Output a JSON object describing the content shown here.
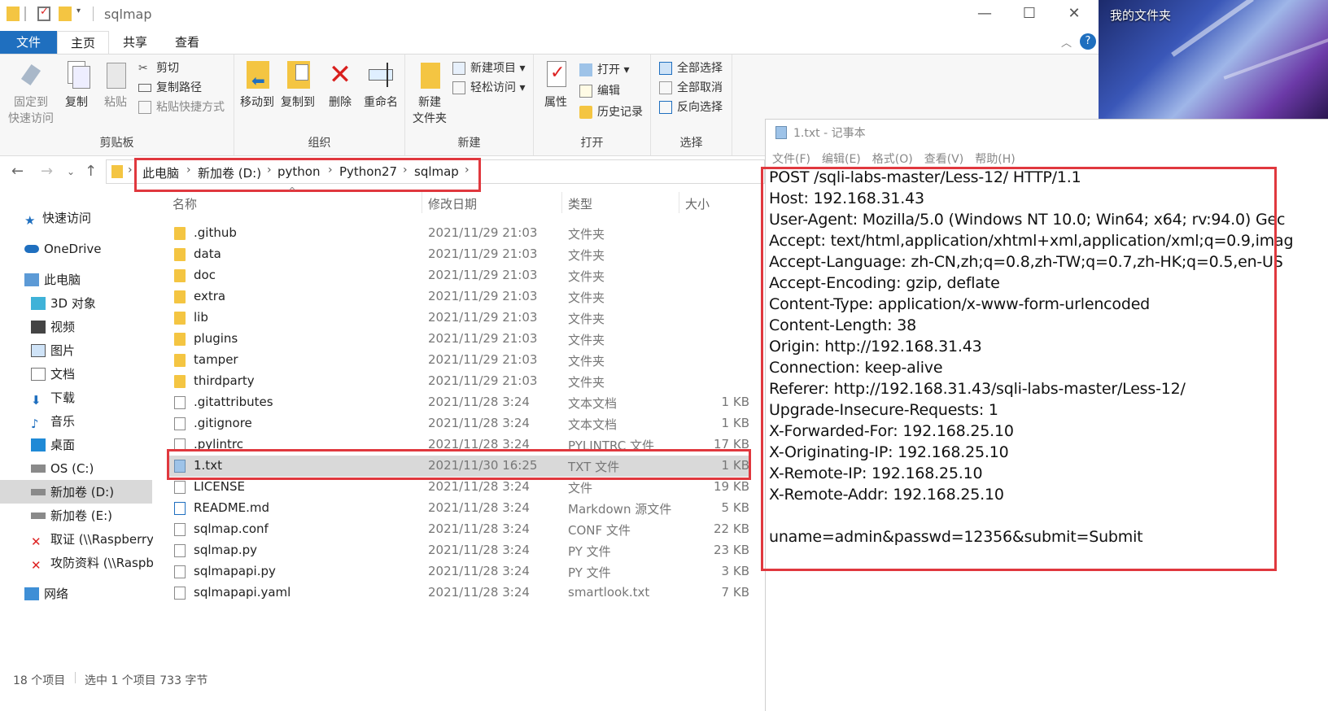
{
  "explorer": {
    "window_title": "sqlmap",
    "tabs": {
      "file": "文件",
      "home": "主页",
      "share": "共享",
      "view": "查看"
    },
    "ribbon": {
      "clipboard": {
        "label": "剪贴板",
        "pin": "固定到\n快速访问",
        "pin_l1": "固定到",
        "pin_l2": "快速访问",
        "copy": "复制",
        "paste": "粘贴",
        "cut": "剪切",
        "copy_path": "复制路径",
        "paste_shortcut": "粘贴快捷方式"
      },
      "organize": {
        "label": "组织",
        "move_to": "移动到",
        "copy_to": "复制到",
        "delete": "删除",
        "rename": "重命名"
      },
      "new": {
        "label": "新建",
        "new_folder_l1": "新建",
        "new_folder_l2": "文件夹",
        "new_item": "新建项目",
        "easy_access": "轻松访问"
      },
      "open": {
        "label": "打开",
        "properties": "属性",
        "open": "打开",
        "edit": "编辑",
        "history": "历史记录"
      },
      "select": {
        "label": "选择",
        "select_all": "全部选择",
        "select_none": "全部取消",
        "invert": "反向选择"
      }
    },
    "breadcrumb": [
      "此电脑",
      "新加卷 (D:)",
      "python",
      "Python27",
      "sqlmap"
    ],
    "sidebar": {
      "quick_access": "快速访问",
      "onedrive": "OneDrive",
      "this_pc": "此电脑",
      "items": [
        "3D 对象",
        "视频",
        "图片",
        "文档",
        "下载",
        "音乐",
        "桌面",
        "OS (C:)",
        "新加卷 (D:)",
        "新加卷 (E:)",
        "取证 (\\\\Raspberryp",
        "攻防资料 (\\\\Raspbe"
      ],
      "network": "网络"
    },
    "columns": {
      "name": "名称",
      "date": "修改日期",
      "type": "类型",
      "size": "大小"
    },
    "files": [
      {
        "name": ".github",
        "date": "2021/11/29 21:03",
        "type": "文件夹",
        "size": "",
        "kind": "folder"
      },
      {
        "name": "data",
        "date": "2021/11/29 21:03",
        "type": "文件夹",
        "size": "",
        "kind": "folder"
      },
      {
        "name": "doc",
        "date": "2021/11/29 21:03",
        "type": "文件夹",
        "size": "",
        "kind": "folder"
      },
      {
        "name": "extra",
        "date": "2021/11/29 21:03",
        "type": "文件夹",
        "size": "",
        "kind": "folder"
      },
      {
        "name": "lib",
        "date": "2021/11/29 21:03",
        "type": "文件夹",
        "size": "",
        "kind": "folder"
      },
      {
        "name": "plugins",
        "date": "2021/11/29 21:03",
        "type": "文件夹",
        "size": "",
        "kind": "folder"
      },
      {
        "name": "tamper",
        "date": "2021/11/29 21:03",
        "type": "文件夹",
        "size": "",
        "kind": "folder"
      },
      {
        "name": "thirdparty",
        "date": "2021/11/29 21:03",
        "type": "文件夹",
        "size": "",
        "kind": "folder"
      },
      {
        "name": ".gitattributes",
        "date": "2021/11/28 3:24",
        "type": "文本文档",
        "size": "1 KB",
        "kind": "doc"
      },
      {
        "name": ".gitignore",
        "date": "2021/11/28 3:24",
        "type": "文本文档",
        "size": "1 KB",
        "kind": "doc"
      },
      {
        "name": ".pylintrc",
        "date": "2021/11/28 3:24",
        "type": "PYLINTRC 文件",
        "size": "17 KB",
        "kind": "doc"
      },
      {
        "name": "1.txt",
        "date": "2021/11/30 16:25",
        "type": "TXT 文件",
        "size": "1 KB",
        "kind": "txt",
        "selected": true
      },
      {
        "name": "LICENSE",
        "date": "2021/11/28 3:24",
        "type": "文件",
        "size": "19 KB",
        "kind": "doc"
      },
      {
        "name": "README.md",
        "date": "2021/11/28 3:24",
        "type": "Markdown 源文件",
        "size": "5 KB",
        "kind": "md"
      },
      {
        "name": "sqlmap.conf",
        "date": "2021/11/28 3:24",
        "type": "CONF 文件",
        "size": "22 KB",
        "kind": "doc"
      },
      {
        "name": "sqlmap.py",
        "date": "2021/11/28 3:24",
        "type": "PY 文件",
        "size": "23 KB",
        "kind": "doc"
      },
      {
        "name": "sqlmapapi.py",
        "date": "2021/11/28 3:24",
        "type": "PY 文件",
        "size": "3 KB",
        "kind": "doc"
      },
      {
        "name": "sqlmapapi.yaml",
        "date": "2021/11/28 3:24",
        "type": "smartlook.txt",
        "size": "7 KB",
        "kind": "doc"
      }
    ],
    "status": {
      "count": "18 个项目",
      "selection": "选中 1 个项目  733 字节"
    }
  },
  "desktop": {
    "folder_label": "我的文件夹"
  },
  "notepad": {
    "title": "1.txt - 记事本",
    "menu": [
      "文件(F)",
      "编辑(E)",
      "格式(O)",
      "查看(V)",
      "帮助(H)"
    ],
    "lines": [
      "POST /sqli-labs-master/Less-12/ HTTP/1.1",
      "Host: 192.168.31.43",
      "User-Agent: Mozilla/5.0 (Windows NT 10.0; Win64; x64; rv:94.0) Gec",
      "Accept: text/html,application/xhtml+xml,application/xml;q=0.9,imag",
      "Accept-Language: zh-CN,zh;q=0.8,zh-TW;q=0.7,zh-HK;q=0.5,en-US",
      "Accept-Encoding: gzip, deflate",
      "Content-Type: application/x-www-form-urlencoded",
      "Content-Length: 38",
      "Origin: http://192.168.31.43",
      "Connection: keep-alive",
      "Referer: http://192.168.31.43/sqli-labs-master/Less-12/",
      "Upgrade-Insecure-Requests: 1",
      "X-Forwarded-For: 192.168.25.10",
      "X-Originating-IP: 192.168.25.10",
      "X-Remote-IP: 192.168.25.10",
      "X-Remote-Addr: 192.168.25.10",
      "",
      "uname=admin&passwd=12356&submit=Submit"
    ]
  },
  "colors": {
    "accent": "#1f6fbf",
    "highlight": "#e0383e",
    "folder": "#f4c542",
    "selected_row": "#d9d9d9"
  }
}
